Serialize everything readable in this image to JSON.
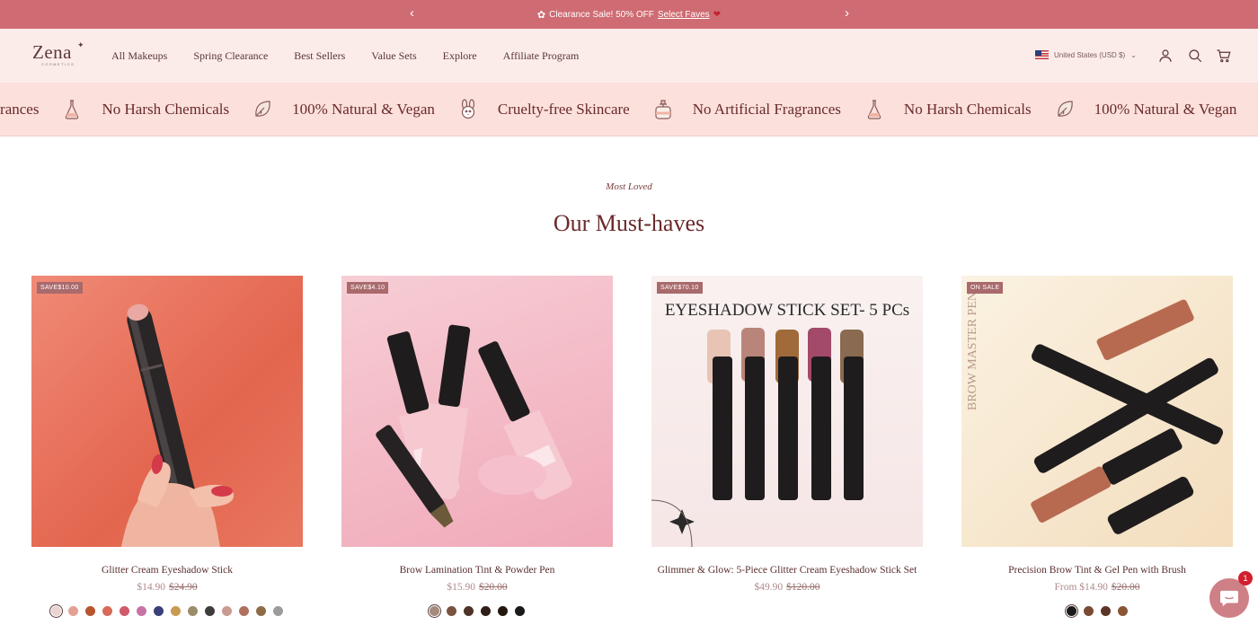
{
  "announcement": {
    "text": "Clearance Sale! 50% OFF",
    "link": "Select Faves",
    "prev_icon": "chevron-left-icon",
    "next_icon": "chevron-right-icon"
  },
  "header": {
    "logo_word": "Zena",
    "logo_sub": "COSMETICS",
    "nav": [
      "All Makeups",
      "Spring Clearance",
      "Best Sellers",
      "Value Sets",
      "Explore",
      "Affiliate Program"
    ],
    "locale": "United States (USD $)"
  },
  "marquee": {
    "items": [
      {
        "text": "agrances",
        "icon": "flask-icon"
      },
      {
        "text": "No Harsh Chemicals",
        "icon": "leaf-icon"
      },
      {
        "text": "100% Natural & Vegan",
        "icon": "bunny-icon"
      },
      {
        "text": "Cruelty-free Skincare",
        "icon": "perfume-icon"
      },
      {
        "text": "No Artificial Fragrances",
        "icon": "flask-icon"
      },
      {
        "text": "No Harsh Chemicals",
        "icon": "leaf-icon"
      },
      {
        "text": "100% Natural & Vegan",
        "icon": ""
      }
    ]
  },
  "section": {
    "eyebrow": "Most Loved",
    "title": "Our Must-haves"
  },
  "products": [
    {
      "badge": "SAVE$10.00",
      "name": "Glitter Cream Eyeshadow Stick",
      "price": "$14.90",
      "compare_price": "$24.90",
      "swatches": [
        "#ead3d3",
        "#e3a195",
        "#b8552e",
        "#d86a58",
        "#cf5a6c",
        "#c774a5",
        "#3a3f7a",
        "#c99a52",
        "#9c8d6a",
        "#3f3c3c",
        "#c99b93",
        "#b07060",
        "#8e6c47",
        "#9c9c9c"
      ],
      "bg": "#e8735f"
    },
    {
      "badge": "SAVE$4.10",
      "name": "Brow Lamination Tint & Powder Pen",
      "price": "$15.90",
      "compare_price": "$20.00",
      "swatches": [
        "#a38a7a",
        "#7a5240",
        "#4e3328",
        "#2f1d18",
        "#24170f",
        "#1a1a1a"
      ],
      "bg": "#f3bcc7"
    },
    {
      "badge": "SAVE$70.10",
      "name": "Glimmer & Glow: 5-Piece Glitter Cream Eyeshadow Stick Set",
      "image_text": "EYESHADOW STICK SET- 5 PCs",
      "price": "$49.90",
      "compare_price": "$120.00",
      "swatches": [],
      "bg": "#f7eeee"
    },
    {
      "badge": "ON SALE",
      "name": "Precision Brow Tint & Gel Pen with Brush",
      "image_text": "BROW MASTER PEN",
      "price": "From $14.90",
      "compare_price": "$20.00",
      "swatches": [
        "#1a1a1a",
        "#7a4a35",
        "#5a3528",
        "#8a5535"
      ],
      "bg": "#f4e3c8"
    }
  ],
  "chat": {
    "count": "1",
    "icon": "chat-bubble-icon"
  }
}
